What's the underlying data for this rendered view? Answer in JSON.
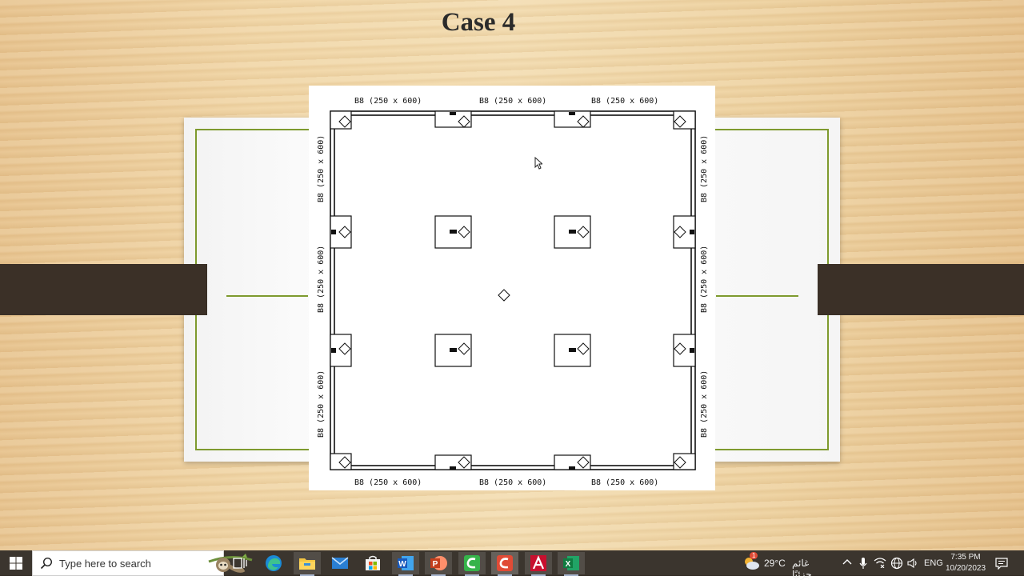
{
  "slide": {
    "title": "Case 4",
    "beam_labels": {
      "top": [
        "B8 (250 x 600)",
        "B8 (250 x 600)",
        "B8 (250 x 600)"
      ],
      "bottom": [
        "B8 (250 x 600)",
        "B8 (250 x 600)",
        "B8 (250 x 600)"
      ],
      "left": [
        "B8 (250 x 600)",
        "B8 (250 x 600)",
        "B8 (250 x 600)"
      ],
      "right": [
        "B8 (250 x 600)",
        "B8 (250 x 600)",
        "B8 (250 x 600)"
      ]
    }
  },
  "taskbar": {
    "search_placeholder": "Type here to search",
    "apps": [
      {
        "name": "task-view-icon"
      },
      {
        "name": "edge-icon"
      },
      {
        "name": "file-explorer-icon"
      },
      {
        "name": "mail-icon"
      },
      {
        "name": "microsoft-store-icon"
      },
      {
        "name": "word-icon"
      },
      {
        "name": "powerpoint-icon"
      },
      {
        "name": "camtasia-green-icon"
      },
      {
        "name": "camtasia-red-icon"
      },
      {
        "name": "autocad-icon"
      },
      {
        "name": "excel-icon"
      }
    ],
    "weather": {
      "temp": "29°C",
      "desc": "غائم جزئيًا",
      "badge": "1"
    },
    "language": "ENG",
    "time": "7:35 PM",
    "date": "10/20/2023"
  },
  "colors": {
    "taskbar": "#3b352e",
    "frame_green": "#7e9a2e",
    "dark_bar": "#3b3027"
  }
}
